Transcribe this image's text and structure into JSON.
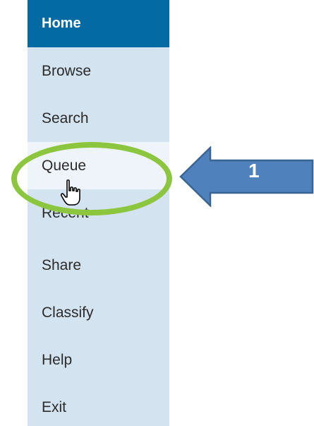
{
  "nav": {
    "items": [
      {
        "label": "Home"
      },
      {
        "label": "Browse"
      },
      {
        "label": "Search"
      },
      {
        "label": "Queue"
      },
      {
        "label": "Recent"
      },
      {
        "label": "Share"
      },
      {
        "label": "Classify"
      },
      {
        "label": "Help"
      },
      {
        "label": "Exit"
      }
    ],
    "active_color": "#036aa3",
    "background_color": "#d3e3ef"
  },
  "annotation": {
    "step_number": "1",
    "arrow_color": "#4f81bd",
    "ring_color": "#8cc63f",
    "cursor": "hand-pointer-icon"
  }
}
